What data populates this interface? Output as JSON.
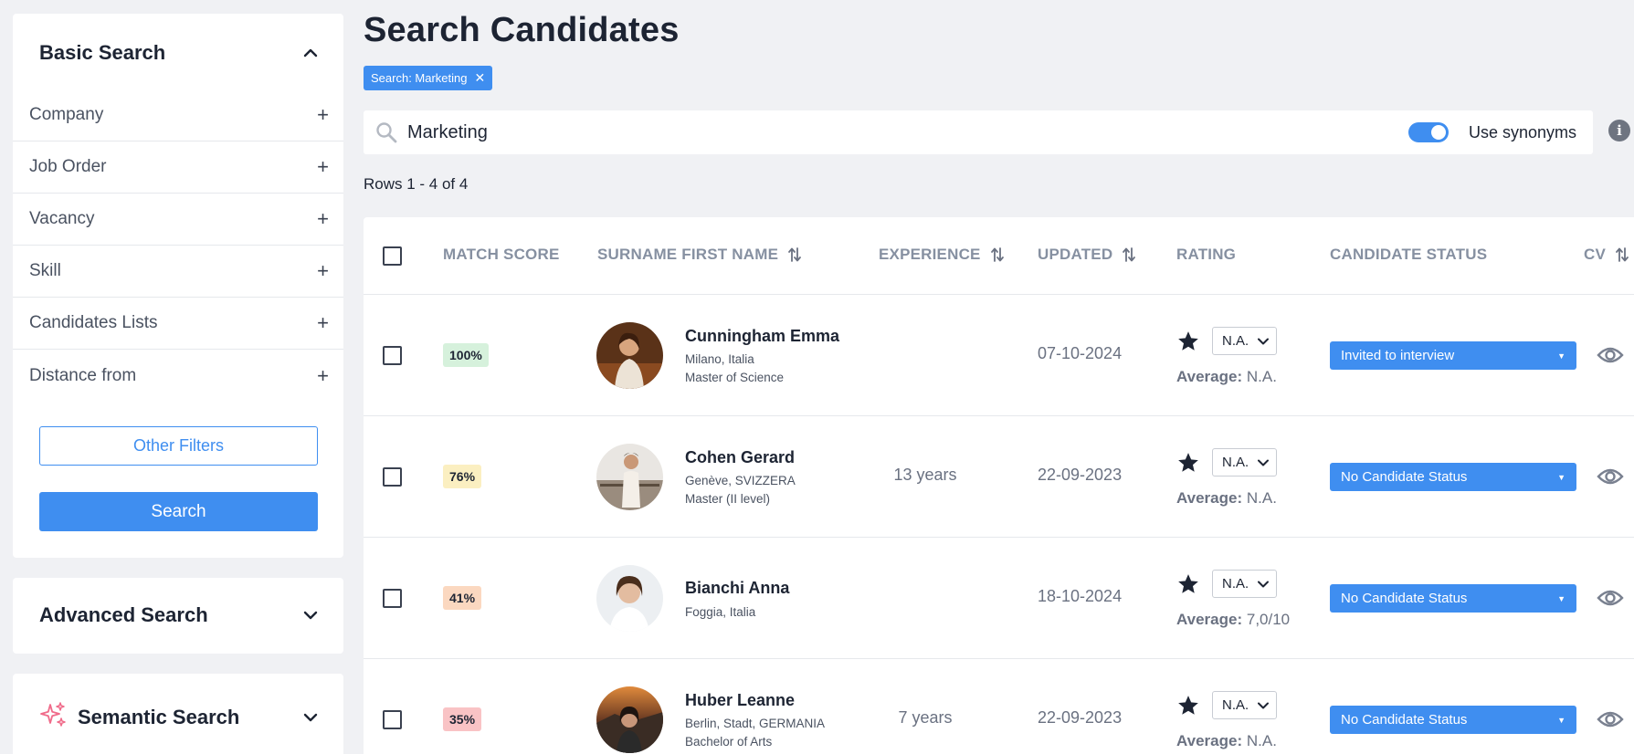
{
  "sidebar": {
    "basic_title": "Basic Search",
    "filters": [
      "Company",
      "Job Order",
      "Vacancy",
      "Skill",
      "Candidates Lists",
      "Distance from"
    ],
    "other_filters_label": "Other Filters",
    "search_label": "Search",
    "advanced_title": "Advanced Search",
    "semantic_title": "Semantic Search"
  },
  "main": {
    "title": "Search Candidates",
    "chip_label": "Search: Marketing",
    "search_value": "Marketing",
    "synonyms_label": "Use synonyms",
    "synonyms_on": true,
    "rows_text": "Rows 1 - 4 of 4"
  },
  "table": {
    "headers": {
      "match": "MATCH SCORE",
      "name": "SURNAME FIRST NAME",
      "experience": "EXPERIENCE",
      "updated": "UPDATED",
      "rating": "RATING",
      "status": "CANDIDATE STATUS",
      "cv": "CV"
    },
    "average_label": "Average:",
    "rows": [
      {
        "score": "100%",
        "score_color": "#d6f1dc",
        "name": "Cunningham Emma",
        "location": "Milano, Italia",
        "degree": "Master of Science",
        "experience": "",
        "updated": "07-10-2024",
        "rating": "N.A.",
        "average": "N.A.",
        "status": "Invited to interview"
      },
      {
        "score": "76%",
        "score_color": "#fbefc1",
        "name": "Cohen Gerard",
        "location": "Genève, SVIZZERA",
        "degree": "Master (II level)",
        "experience": "13 years",
        "updated": "22-09-2023",
        "rating": "N.A.",
        "average": "N.A.",
        "status": "No Candidate Status"
      },
      {
        "score": "41%",
        "score_color": "#fbd8c0",
        "name": "Bianchi Anna",
        "location": "Foggia, Italia",
        "degree": "",
        "experience": "",
        "updated": "18-10-2024",
        "rating": "N.A.",
        "average": "7,0/10",
        "status": "No Candidate Status"
      },
      {
        "score": "35%",
        "score_color": "#f9c3c5",
        "name": "Huber Leanne",
        "location": "Berlin, Stadt, GERMANIA",
        "degree": "Bachelor of Arts",
        "experience": "7 years",
        "updated": "22-09-2023",
        "rating": "N.A.",
        "average": "N.A.",
        "status": "No Candidate Status"
      }
    ]
  },
  "colors": {
    "accent": "#3f8ef0",
    "semantic_icon": "#f06b8a"
  }
}
